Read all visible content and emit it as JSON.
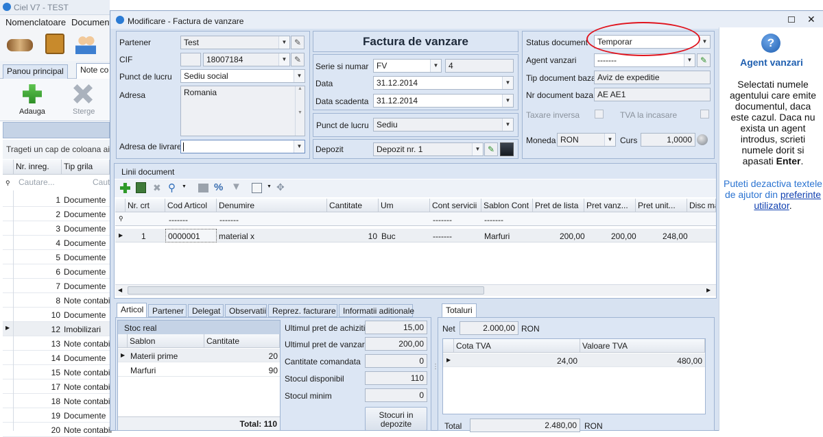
{
  "main_window": {
    "title": "Ciel V7 - TEST",
    "menu": [
      "Nomenclatoare",
      "Documente"
    ],
    "toolbar_tabs": [
      "Panou principal",
      "Note co"
    ],
    "actions": {
      "add": "Adauga",
      "delete": "Sterge"
    },
    "group_hint": "Trageti un cap de coloana aici p",
    "columns": [
      "Nr. inreg.",
      "Tip grila"
    ],
    "search_placeholder": "Cautare...",
    "search_placeholder2": "Caut",
    "rows": [
      {
        "nr": "1",
        "tip": "Documente"
      },
      {
        "nr": "2",
        "tip": "Documente"
      },
      {
        "nr": "3",
        "tip": "Documente"
      },
      {
        "nr": "4",
        "tip": "Documente"
      },
      {
        "nr": "5",
        "tip": "Documente"
      },
      {
        "nr": "6",
        "tip": "Documente"
      },
      {
        "nr": "7",
        "tip": "Documente"
      },
      {
        "nr": "8",
        "tip": "Note contabil"
      },
      {
        "nr": "10",
        "tip": "Documente"
      },
      {
        "nr": "12",
        "tip": "Imobilizari"
      },
      {
        "nr": "13",
        "tip": "Note contabil"
      },
      {
        "nr": "14",
        "tip": "Documente"
      },
      {
        "nr": "15",
        "tip": "Note contabil"
      },
      {
        "nr": "17",
        "tip": "Note contabil"
      },
      {
        "nr": "18",
        "tip": "Note contabil"
      },
      {
        "nr": "19",
        "tip": "Documente"
      },
      {
        "nr": "20",
        "tip": "Note contabil"
      }
    ]
  },
  "dialog": {
    "title": "Modificare - Factura de vanzare",
    "heading": "Factura de vanzare",
    "partener_label": "Partener",
    "partener": "Test",
    "cif_label": "CIF",
    "cif": "18007184",
    "punct_label": "Punct de lucru",
    "punct": "Sediu social",
    "adresa_label": "Adresa",
    "adresa": "Romania",
    "livrare_label": "Adresa de livrare",
    "livrare": "",
    "serie_label": "Serie si numar",
    "serie": "FV",
    "numar": "4",
    "data_label": "Data",
    "data": "31.12.2014",
    "scad_label": "Data scadenta",
    "scad": "31.12.2014",
    "punct2_label": "Punct de lucru",
    "punct2": "Sediu",
    "depozit_label": "Depozit",
    "depozit": "Depozit nr. 1",
    "status_label": "Status document",
    "status": "Temporar",
    "agent_label": "Agent vanzari",
    "agent": "-------",
    "tipbaza_label": "Tip document baza",
    "tipbaza": "Aviz de expeditie",
    "nrbaza_label": "Nr document baza",
    "nrbaza": "AE AE1",
    "taxare_label": "Taxare inversa",
    "tva_label": "TVA la incasare",
    "moneda_label": "Moneda",
    "moneda": "RON",
    "curs_label": "Curs",
    "curs": "1,0000",
    "lines_title": "Linii document",
    "line_cols": [
      "Nr. crt",
      "Cod Articol",
      "Denumire",
      "Cantitate",
      "Um",
      "Cont servicii",
      "Sablon Cont",
      "Pret de lista",
      "Pret vanz...",
      "Pret unit...",
      "Disc ma"
    ],
    "filter_dashes": "-------",
    "line": {
      "nr": "1",
      "cod": "0000001",
      "den": "material x",
      "cant": "10",
      "um": "Buc",
      "cont": "-------",
      "sablon": "Marfuri",
      "lista": "200,00",
      "vanz": "200,00",
      "unit": "248,00"
    },
    "tabs": [
      "Articol",
      "Partener",
      "Delegat",
      "Observatii",
      "Reprez. facturare",
      "Informatii aditionale"
    ],
    "stoc_title": "Stoc real",
    "stoc_cols": [
      "Sablon",
      "Cantitate"
    ],
    "stoc_rows": [
      {
        "s": "Materii prime",
        "c": "20"
      },
      {
        "s": "Marfuri",
        "c": "90"
      }
    ],
    "stoc_total": "Total: 110",
    "ultim_ach_label": "Ultimul pret de achizitie",
    "ultim_ach": "15,00",
    "ultim_vz_label": "Ultimul pret de vanzare",
    "ultim_vz": "200,00",
    "cant_cmd_label": "Cantitate comandata",
    "cant_cmd": "0",
    "stoc_disp_label": "Stocul disponibil",
    "stoc_disp": "110",
    "stoc_min_label": "Stocul minim",
    "stoc_min": "0",
    "stocuri_btn": "Stocuri in depozite",
    "totaluri_tab": "Totaluri",
    "net_label": "Net",
    "net": "2.000,00",
    "net_cur": "RON",
    "tva_cols": [
      "Cota TVA",
      "Valoare TVA"
    ],
    "tva_row": {
      "cota": "24,00",
      "val": "480,00"
    },
    "total_label": "Total",
    "total": "2.480,00",
    "total_cur": "RON"
  },
  "help": {
    "title": "Agent vanzari",
    "text": "Selectati numele agentului care emite documentul, daca este cazul. Daca nu exista un agent introdus, scrieti numele dorit si apasati",
    "enter": "Enter",
    "dot": ".",
    "text2": "Puteti dezactiva textele de ajutor din",
    "link": "preferinte utilizator",
    "dot2": "."
  },
  "colors": {
    "accent": "#1f5fb0",
    "panel": "#dce6f4",
    "annotation": "#e0141e"
  }
}
